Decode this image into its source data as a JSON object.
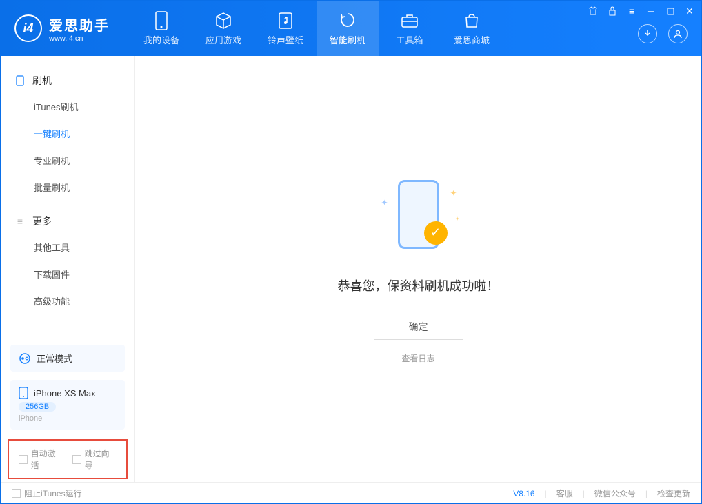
{
  "app": {
    "title": "爱思助手",
    "subtitle": "www.i4.cn"
  },
  "nav": {
    "items": [
      {
        "label": "我的设备"
      },
      {
        "label": "应用游戏"
      },
      {
        "label": "铃声壁纸"
      },
      {
        "label": "智能刷机"
      },
      {
        "label": "工具箱"
      },
      {
        "label": "爱思商城"
      }
    ]
  },
  "sidebar": {
    "group1": {
      "title": "刷机",
      "items": [
        "iTunes刷机",
        "一键刷机",
        "专业刷机",
        "批量刷机"
      ]
    },
    "group2": {
      "title": "更多",
      "items": [
        "其他工具",
        "下载固件",
        "高级功能"
      ]
    }
  },
  "device": {
    "mode": "正常模式",
    "name": "iPhone XS Max",
    "storage": "256GB",
    "type": "iPhone"
  },
  "options": {
    "auto_activate": "自动激活",
    "skip_guide": "跳过向导"
  },
  "main": {
    "success_text": "恭喜您，保资料刷机成功啦！",
    "ok_button": "确定",
    "view_log": "查看日志"
  },
  "footer": {
    "block_itunes": "阻止iTunes运行",
    "version": "V8.16",
    "support": "客服",
    "wechat": "微信公众号",
    "update": "检查更新"
  }
}
